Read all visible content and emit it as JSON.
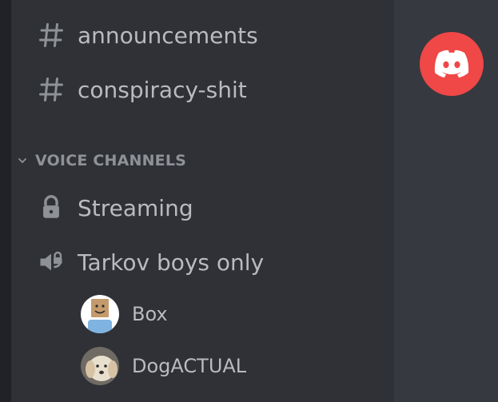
{
  "text_channels": [
    {
      "name": "announcements",
      "icon": "hashtag-icon"
    },
    {
      "name": "conspiracy-shit",
      "icon": "hashtag-icon"
    }
  ],
  "voice_category": {
    "label": "VOICE CHANNELS",
    "icon": "chevron-down-icon"
  },
  "voice_channels": [
    {
      "name": "Streaming",
      "icon": "lock-icon"
    },
    {
      "name": "Tarkov boys only",
      "icon": "speaker-lock-icon"
    }
  ],
  "voice_users": [
    {
      "name": "Box",
      "avatar": "box-head-avatar"
    },
    {
      "name": "DogACTUAL",
      "avatar": "dog-avatar"
    }
  ],
  "colors": {
    "sidebar": "#2f3136",
    "background": "#36393f",
    "logo_red": "#f04747",
    "text_muted": "#8e9297",
    "text": "#b9bbbe"
  }
}
